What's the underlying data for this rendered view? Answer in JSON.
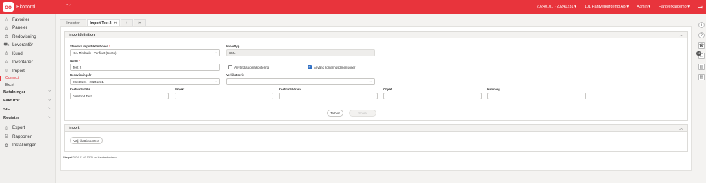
{
  "topbar": {
    "logo": "oo",
    "app_name": "Ekonomi",
    "period": "20240101 - 20241231",
    "company": "101 Hantverkardemo AB",
    "role": "Admin",
    "user": "Hantverkardemo",
    "caret": "▾",
    "app_chevron": "﹀",
    "exit_glyph": "⇥"
  },
  "sidebar": {
    "items": [
      {
        "label": "Favoriter",
        "icon": "☆"
      },
      {
        "label": "Paneler",
        "icon": "◎"
      },
      {
        "label": "Redovisning",
        "icon": "⚖"
      },
      {
        "label": "Leverantör",
        "icon": "⛟"
      },
      {
        "label": "Kund",
        "icon": "♙"
      },
      {
        "label": "Inventarier",
        "icon": "⌂"
      },
      {
        "label": "Import",
        "icon": "⇩"
      }
    ],
    "sub_items": [
      "Connect",
      "Excel"
    ],
    "groups": [
      "Betalningar",
      "Fakturor",
      "SIE",
      "Register"
    ],
    "bottom": [
      {
        "label": "Export",
        "icon": "⇧"
      },
      {
        "label": "Rapporter",
        "icon": "⎙"
      },
      {
        "label": "Inställningar",
        "icon": "⚙"
      }
    ],
    "chevron": "﹀"
  },
  "tabs": [
    {
      "label": "Importer"
    },
    {
      "label": "Import Test 2",
      "close": "✕"
    },
    {
      "label": "+"
    },
    {
      "label": "✕"
    }
  ],
  "importdef": {
    "title": "Importdefinition",
    "collapse": "︿",
    "std_label": "Standard importdefinitionen",
    "req": "*",
    "std_value": "ICA Minibutik - Verifikat (Konto)",
    "dd": "⌄",
    "type_label": "Importtyp",
    "type_value": "XML",
    "name_label": "Namn",
    "name_value": "Test 2",
    "chk1": "Använd automatkontering",
    "chk2": "Använd konteringsdimensioner",
    "check": "✓",
    "year_label": "Redovisningsår",
    "year_value": "20240101 - 20241231",
    "series_label": "Verifikatserie",
    "series_value": "",
    "dims": [
      {
        "label": "Kostnadsställe",
        "value": "0 Anfood Test"
      },
      {
        "label": "Projekt",
        "value": ""
      },
      {
        "label": "Kostnadsbärare",
        "value": ""
      },
      {
        "label": "Objekt",
        "value": ""
      },
      {
        "label": "Kampanj",
        "value": ""
      }
    ],
    "remove_btn": "Ta bort",
    "save_btn": "Spara"
  },
  "import": {
    "title": "Import",
    "collapse": "︿",
    "choose_btn": "Välj fil att importera"
  },
  "footer": {
    "created_label": "Skapad",
    "created_value": "2024-11-07 13:28",
    "by_label": "av",
    "by_value": "Hantverkardemo"
  },
  "right_rail": {
    "icons": [
      "i",
      "?",
      "☎",
      "❐",
      "▤",
      "▤"
    ],
    "badge": "12"
  }
}
